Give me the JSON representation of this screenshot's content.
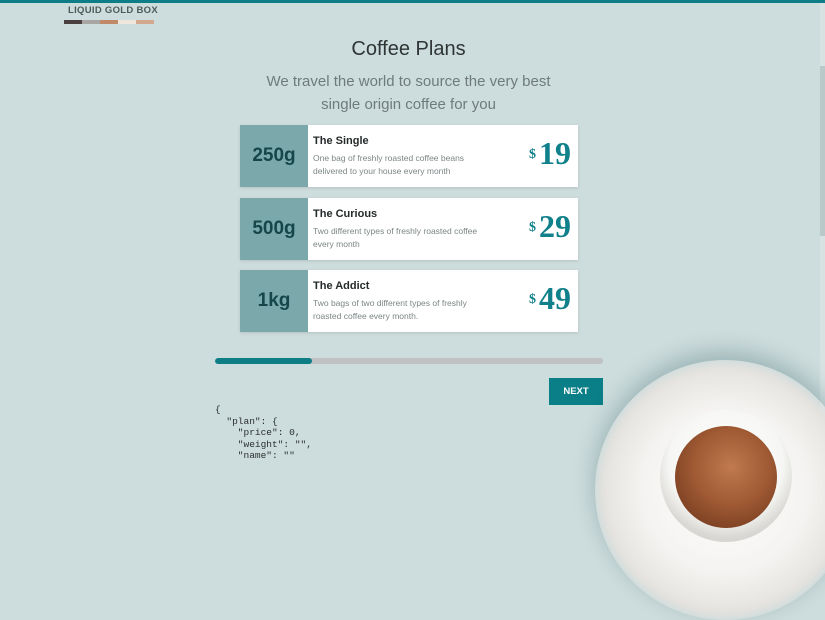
{
  "brand": {
    "name": "LIQUID GOLD BOX",
    "swatches": [
      "#4a4040",
      "#a8a6a2",
      "#c08a68",
      "#efe6dc",
      "#d2a98c"
    ]
  },
  "page": {
    "title": "Coffee Plans",
    "subtitle_line1": "We travel the world to source the very best",
    "subtitle_line2": "single origin coffee for you"
  },
  "plans": [
    {
      "weight": "250g",
      "name": "The Single",
      "desc_line1": "One bag of freshly roasted coffee beans",
      "desc_line2": "delivered to your house every month",
      "currency": "$",
      "price": "19"
    },
    {
      "weight": "500g",
      "name": "The Curious",
      "desc_line1": "Two different types of freshly roasted coffee",
      "desc_line2": "every month",
      "currency": "$",
      "price": "29"
    },
    {
      "weight": "1kg",
      "name": "The Addict",
      "desc_line1": "Two bags of two different types of freshly",
      "desc_line2": "roasted coffee every month.",
      "currency": "$",
      "price": "49"
    }
  ],
  "progress": {
    "value_pct": 25
  },
  "next_button": {
    "label": "NEXT"
  },
  "json_output": {
    "line1": "{",
    "line2": "  \"plan\": {",
    "line3": "    \"price\": 0,",
    "line4": "    \"weight\": \"\",",
    "line5": "    \"name\": \"\""
  },
  "colors": {
    "accent": "#0d7e86",
    "background": "#cddcdc",
    "weight_tile": "#7aa8ab"
  }
}
